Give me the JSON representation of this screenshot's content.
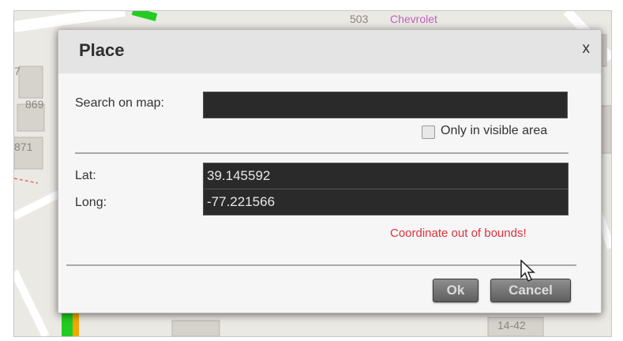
{
  "map": {
    "labels": {
      "house_503": "503",
      "chevrolet": "Chevrolet",
      "house_869": "869",
      "house_871": "871",
      "house_7": "7",
      "house_1442": "14-42"
    }
  },
  "dialog": {
    "title": "Place",
    "close_label": "x",
    "search_label": "Search on map:",
    "search_value": "",
    "visible_area_label": "Only in visible area",
    "visible_area_checked": false,
    "lat_label": "Lat:",
    "lat_value": "39.145592",
    "long_label": "Long:",
    "long_value": "-77.221566",
    "error_text": "Coordinate out of bounds!",
    "ok_label": "Ok",
    "cancel_label": "Cancel"
  },
  "colors": {
    "error": "#e0303c",
    "field_bg": "#2a2a2a",
    "road_green": "#22cc22"
  }
}
